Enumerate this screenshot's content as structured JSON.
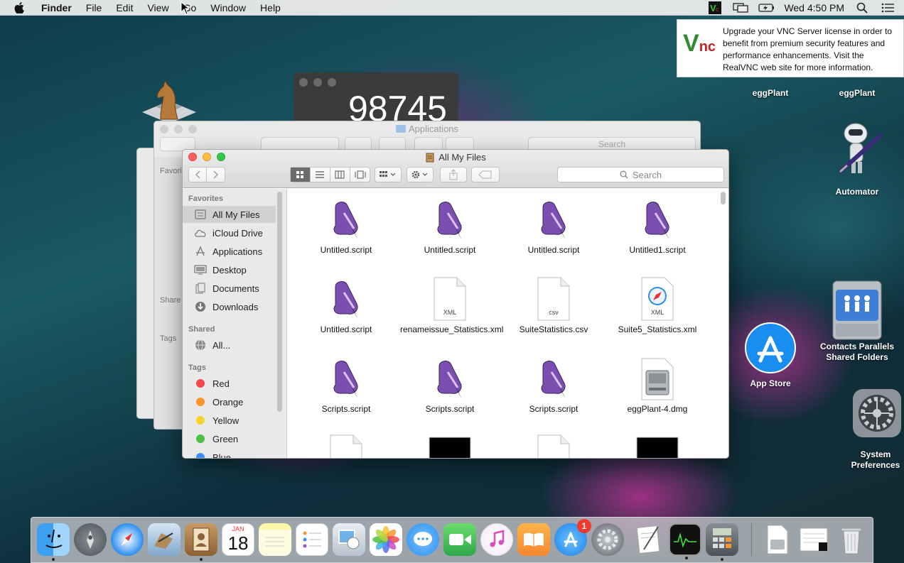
{
  "menubar": {
    "app_name": "Finder",
    "items": [
      "File",
      "Edit",
      "View",
      "Go",
      "Window",
      "Help"
    ],
    "clock": "Wed 4:50 PM"
  },
  "vnc_notification": {
    "text": "Upgrade your VNC Server license in order to benefit from premium security features and performance enhancements. Visit the RealVNC web site for more information."
  },
  "desktop": {
    "icons": [
      {
        "label": "eggPlant"
      },
      {
        "label": "eggPlant"
      },
      {
        "label": "Automator"
      },
      {
        "label": "Contacts Parallels Shared Folders"
      },
      {
        "label": "App Store"
      },
      {
        "label": "System Preferences"
      }
    ]
  },
  "calculator": {
    "display": "98745"
  },
  "back_window": {
    "title": "Applications",
    "search_placeholder": "Search",
    "sidebar_fragments": [
      "Favori",
      "Share",
      "Tags"
    ]
  },
  "finder": {
    "title": "All My Files",
    "search_placeholder": "Search",
    "sidebar": {
      "favorites_header": "Favorites",
      "favorites": [
        "All My Files",
        "iCloud Drive",
        "Applications",
        "Desktop",
        "Documents",
        "Downloads"
      ],
      "shared_header": "Shared",
      "shared": [
        "All..."
      ],
      "tags_header": "Tags",
      "tags": [
        {
          "label": "Red",
          "color": "#f1484b"
        },
        {
          "label": "Orange",
          "color": "#f7962f"
        },
        {
          "label": "Yellow",
          "color": "#f5d12b"
        },
        {
          "label": "Green",
          "color": "#4bc043"
        },
        {
          "label": "Blue",
          "color": "#3d8ef5"
        }
      ]
    },
    "files": [
      {
        "name": "Untitled.script",
        "type": "script"
      },
      {
        "name": "Untitled.script",
        "type": "script"
      },
      {
        "name": "Untitled.script",
        "type": "script"
      },
      {
        "name": "Untitled1.script",
        "type": "script"
      },
      {
        "name": "Untitled.script",
        "type": "script"
      },
      {
        "name": "renameissue_Statistics.xml",
        "type": "xml"
      },
      {
        "name": "SuiteStatistics.csv",
        "type": "csv"
      },
      {
        "name": "Suite5_Statistics.xml",
        "type": "xml-safari"
      },
      {
        "name": "Scripts.script",
        "type": "script"
      },
      {
        "name": "Scripts.script",
        "type": "script"
      },
      {
        "name": "Scripts.script",
        "type": "script"
      },
      {
        "name": "eggPlant-4.dmg",
        "type": "dmg"
      }
    ],
    "file_type_labels": {
      "xml": "XML",
      "csv": "csv"
    }
  },
  "dock": {
    "apps": [
      "Finder",
      "Launchpad",
      "Safari",
      "Mail",
      "Contacts",
      "Calendar",
      "Notes",
      "Reminders",
      "Preview",
      "Photos",
      "Messages",
      "FaceTime",
      "iTunes",
      "iBooks",
      "App Store",
      "System Preferences",
      "TextEdit",
      "Activity Monitor",
      "Calculator",
      "Documents",
      "Downloads",
      "Trash"
    ],
    "calendar": {
      "month": "JAN",
      "day": "18"
    },
    "app_store_badge": "1"
  }
}
